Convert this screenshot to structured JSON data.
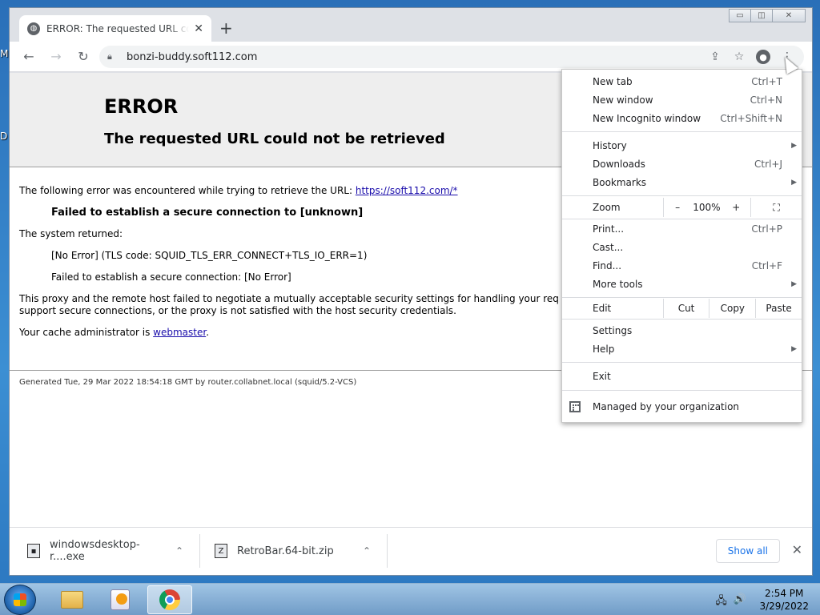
{
  "desktop": {
    "left_labels": [
      "M",
      "D"
    ]
  },
  "window": {
    "controls": {
      "minimize": "▭",
      "maximize": "◫",
      "close": "✕"
    }
  },
  "tab": {
    "title": "ERROR: The requested URL could not be retrieved",
    "favicon": "globe-icon",
    "close": "✕"
  },
  "new_tab_symbol": "+",
  "toolbar": {
    "back": "←",
    "forward": "→",
    "reload": "↻",
    "url": "bonzi-buddy.soft112.com",
    "share": "⇪",
    "star": "☆",
    "menu": "⋮"
  },
  "page": {
    "h1": "ERROR",
    "h2": "The requested URL could not be retrieved",
    "p1_text": "The following error was encountered while trying to retrieve the URL: ",
    "p1_link": "https://soft112.com/*",
    "p2": "Failed to establish a secure connection to [unknown]",
    "p3": "The system returned:",
    "p4": "[No Error] (TLS code: SQUID_TLS_ERR_CONNECT+TLS_IO_ERR=1)",
    "p5": "Failed to establish a secure connection: [No Error]",
    "p6": "This proxy and the remote host failed to negotiate a mutually acceptable security settings for handling your req",
    "p6b": "support secure connections, or the proxy is not satisfied with the host security credentials.",
    "p7_text": "Your cache administrator is ",
    "p7_link": "webmaster",
    "p7_end": ".",
    "generated": "Generated Tue, 29 Mar 2022 18:54:18 GMT by router.collabnet.local (squid/5.2-VCS)"
  },
  "menu": {
    "new_tab": "New tab",
    "new_tab_sc": "Ctrl+T",
    "new_window": "New window",
    "new_window_sc": "Ctrl+N",
    "incognito": "New Incognito window",
    "incognito_sc": "Ctrl+Shift+N",
    "history": "History",
    "downloads": "Downloads",
    "downloads_sc": "Ctrl+J",
    "bookmarks": "Bookmarks",
    "zoom": "Zoom",
    "zoom_minus": "–",
    "zoom_value": "100%",
    "zoom_plus": "+",
    "print": "Print...",
    "print_sc": "Ctrl+P",
    "cast": "Cast...",
    "find": "Find...",
    "find_sc": "Ctrl+F",
    "more_tools": "More tools",
    "edit": "Edit",
    "cut": "Cut",
    "copy": "Copy",
    "paste": "Paste",
    "settings": "Settings",
    "help": "Help",
    "exit": "Exit",
    "managed": "Managed by your organization",
    "arrow": "▶"
  },
  "downloads": {
    "items": [
      {
        "name": "windowsdesktop-r....exe",
        "icon": "exe-file-icon"
      },
      {
        "name": "RetroBar.64-bit.zip",
        "icon": "zip-file-icon"
      }
    ],
    "chevron": "⌃",
    "show_all": "Show all",
    "close": "✕"
  },
  "taskbar": {
    "time": "2:54 PM",
    "date": "3/29/2022",
    "tray_network": "🖧",
    "tray_volume": "🔊"
  }
}
